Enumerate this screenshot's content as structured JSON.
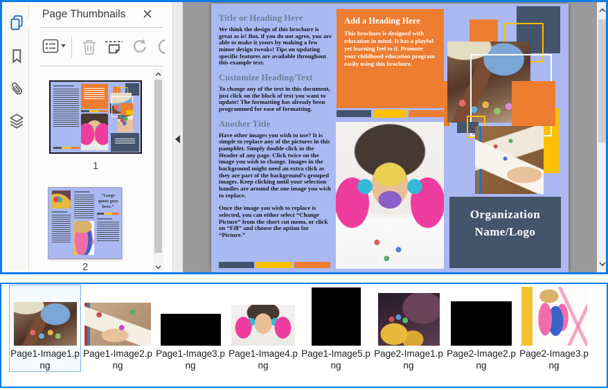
{
  "colors": {
    "accent": "#0c7ce8",
    "page_bg": "#aab9f2",
    "orange": "#ED7D31",
    "yellow": "#FFC000",
    "slate": "#44546A"
  },
  "rail": {
    "icons": [
      "page-thumbnails-icon",
      "bookmarks-icon",
      "attachments-icon",
      "layers-icon"
    ]
  },
  "panel": {
    "title": "Page Thumbnails",
    "toolbar_icons": [
      "thumbnail-options-icon",
      "delete-pages-icon",
      "crop-pages-icon",
      "rotate-left-icon",
      "rotate-right-icon"
    ],
    "pages": [
      {
        "label": "1",
        "selected": true
      },
      {
        "label": "2",
        "selected": false,
        "quote": "“Large quote goes here.”"
      }
    ]
  },
  "document": {
    "page1": {
      "col1": {
        "h1": "Title or Heading Here",
        "p1": "We think the design of this brochure is great as is!  But, if you do not agree, you are able to make it yours by making a few minor design tweaks!  Tips on updating specific features are available throughout this example text.",
        "h2": "Customize Heading/Text",
        "p2": "To change any of the text in this document, just click on the block of text you want to update!  The formatting has already been programmed for ease of formatting.",
        "h3": "Another Title",
        "p3": "Have other images you wish to use?  It is simple to replace any of the pictures in this pamphlet.  Simply double click in the Header of any page.  Click twice on the image you wish to change.  Images in the background might need an extra click as they are part of the background’s grouped images.  Keep clicking until your selection handles are around the one image you wish to replace.",
        "p4": "Once the image you wish to replace is selected, you can either select “Change Picture” from the short cut menu, or click on “Fill” and choose the option for “Picture.”"
      },
      "col2": {
        "h": "Add a Heading Here",
        "p": "This brochure is designed with education in mind.  It has a playful yet learning feel to it.  Promote your childhood education program easily using this brochure."
      },
      "col3": {
        "org_line1": "Organization",
        "org_line2": "Name/Logo"
      }
    }
  },
  "files": {
    "items": [
      {
        "label": "Page1-Image1.png",
        "selected": true
      },
      {
        "label": "Page1-Image2.png",
        "selected": false
      },
      {
        "label": "Page1-Image3.png",
        "selected": false
      },
      {
        "label": "Page1-Image4.png",
        "selected": false
      },
      {
        "label": "Page1-Image5.png",
        "selected": false
      },
      {
        "label": "Page2-Image1.png",
        "selected": false
      },
      {
        "label": "Page2-Image2.png",
        "selected": false
      },
      {
        "label": "Page2-Image3.png",
        "selected": false
      }
    ]
  }
}
